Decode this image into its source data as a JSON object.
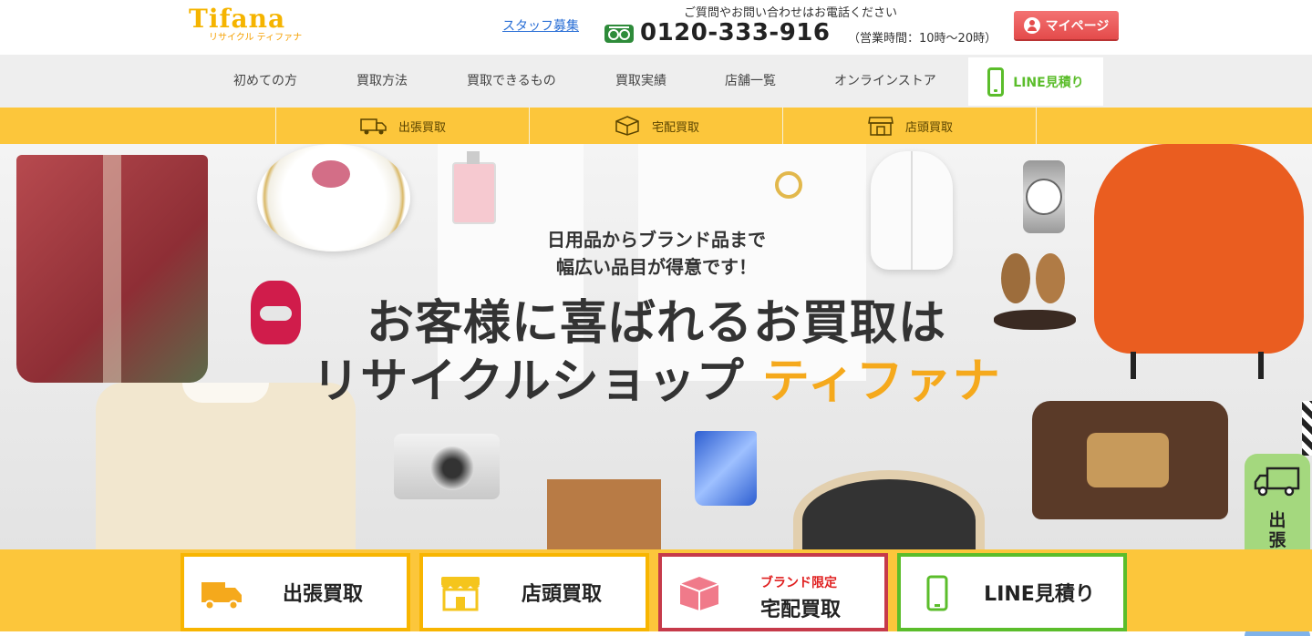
{
  "header": {
    "logo_text": "Tifana",
    "logo_sub": "リサイクル ティファナ",
    "staff_link": "スタッフ募集",
    "contact_note": "ご質問やお問い合わせはお電話ください",
    "phone": "0120-333-916",
    "hours": "（営業時間：10時～20時）",
    "mypage": "マイページ"
  },
  "nav": {
    "items": [
      "初めての方",
      "買取方法",
      "買取できるもの",
      "買取実績",
      "店舗一覧",
      "オンラインストア"
    ],
    "line": "LINE見積り"
  },
  "subnav": {
    "items": [
      "出張買取",
      "宅配買取",
      "店頭買取"
    ]
  },
  "hero": {
    "tagline_1": "日用品からブランド品まで",
    "tagline_2": "幅広い品目が得意です！",
    "headline_1": "お客様に喜ばれるお買取は",
    "headline_2a": "リサイクルショップ",
    "headline_2b": "ティファナ"
  },
  "side_tab": {
    "label": "出張申込"
  },
  "bottom": {
    "cards": [
      {
        "label": "出張買取"
      },
      {
        "label": "店頭買取"
      },
      {
        "label": "宅配買取",
        "sub": "ブランド限定"
      },
      {
        "label": "LINE見積り"
      }
    ]
  },
  "colors": {
    "accent_yellow": "#fcc63b",
    "brand_orange": "#f5a91c",
    "line_green": "#5bbd2b",
    "mypage_red": "#e44b4b",
    "card_red_border": "#c63a4a"
  }
}
